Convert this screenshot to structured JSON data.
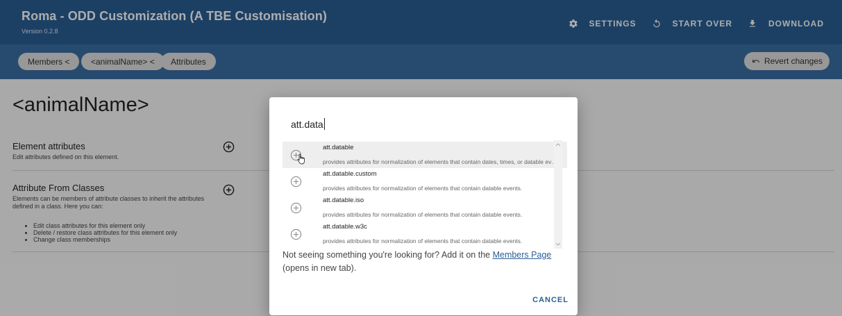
{
  "app": {
    "title": "Roma - ODD Customization (A TBE Customisation)",
    "version": "Version 0.2.8",
    "actions": [
      {
        "label": "SETTINGS",
        "icon": "gear-icon"
      },
      {
        "label": "START OVER",
        "icon": "restart-icon"
      },
      {
        "label": "DOWNLOAD",
        "icon": "download-icon"
      }
    ]
  },
  "breadcrumbs": [
    "Members <",
    "<animalName> <",
    "Attributes"
  ],
  "revert_label": "Revert changes",
  "main": {
    "heading": "<animalName>",
    "element_attributes": {
      "title": "Element attributes",
      "desc": "Edit attributes defined on this element."
    },
    "attribute_from_classes": {
      "title": "Attribute From Classes",
      "desc": "Elements can be members of attribute classes to inherit the attributes defined in a class. Here you can:",
      "bullets": [
        "Edit class attributes for this element only",
        "Delete / restore class attributes for this element only",
        "Change class memberships"
      ]
    }
  },
  "dialog": {
    "search_value": "att.data",
    "items": [
      {
        "name": "att.datable",
        "desc": "provides attributes for normalization of elements that contain dates, times, or datable events."
      },
      {
        "name": "att.datable.custom",
        "desc": "provides attributes for normalization of elements that contain datable events."
      },
      {
        "name": "att.datable.iso",
        "desc": "provides attributes for normalization of elements that contain datable events."
      },
      {
        "name": "att.datable.w3c",
        "desc": "provides attributes for normalization of elements that contain datable events."
      }
    ],
    "not_seeing_prefix": "Not seeing something you're looking for? Add it on the ",
    "members_link": "Members Page",
    "not_seeing_suffix": " (opens in new tab).",
    "cancel_label": "CANCEL"
  },
  "colors": {
    "appbar": "#2a5f94",
    "toolbar": "#3a6fa3",
    "accent": "#2a5f94"
  }
}
